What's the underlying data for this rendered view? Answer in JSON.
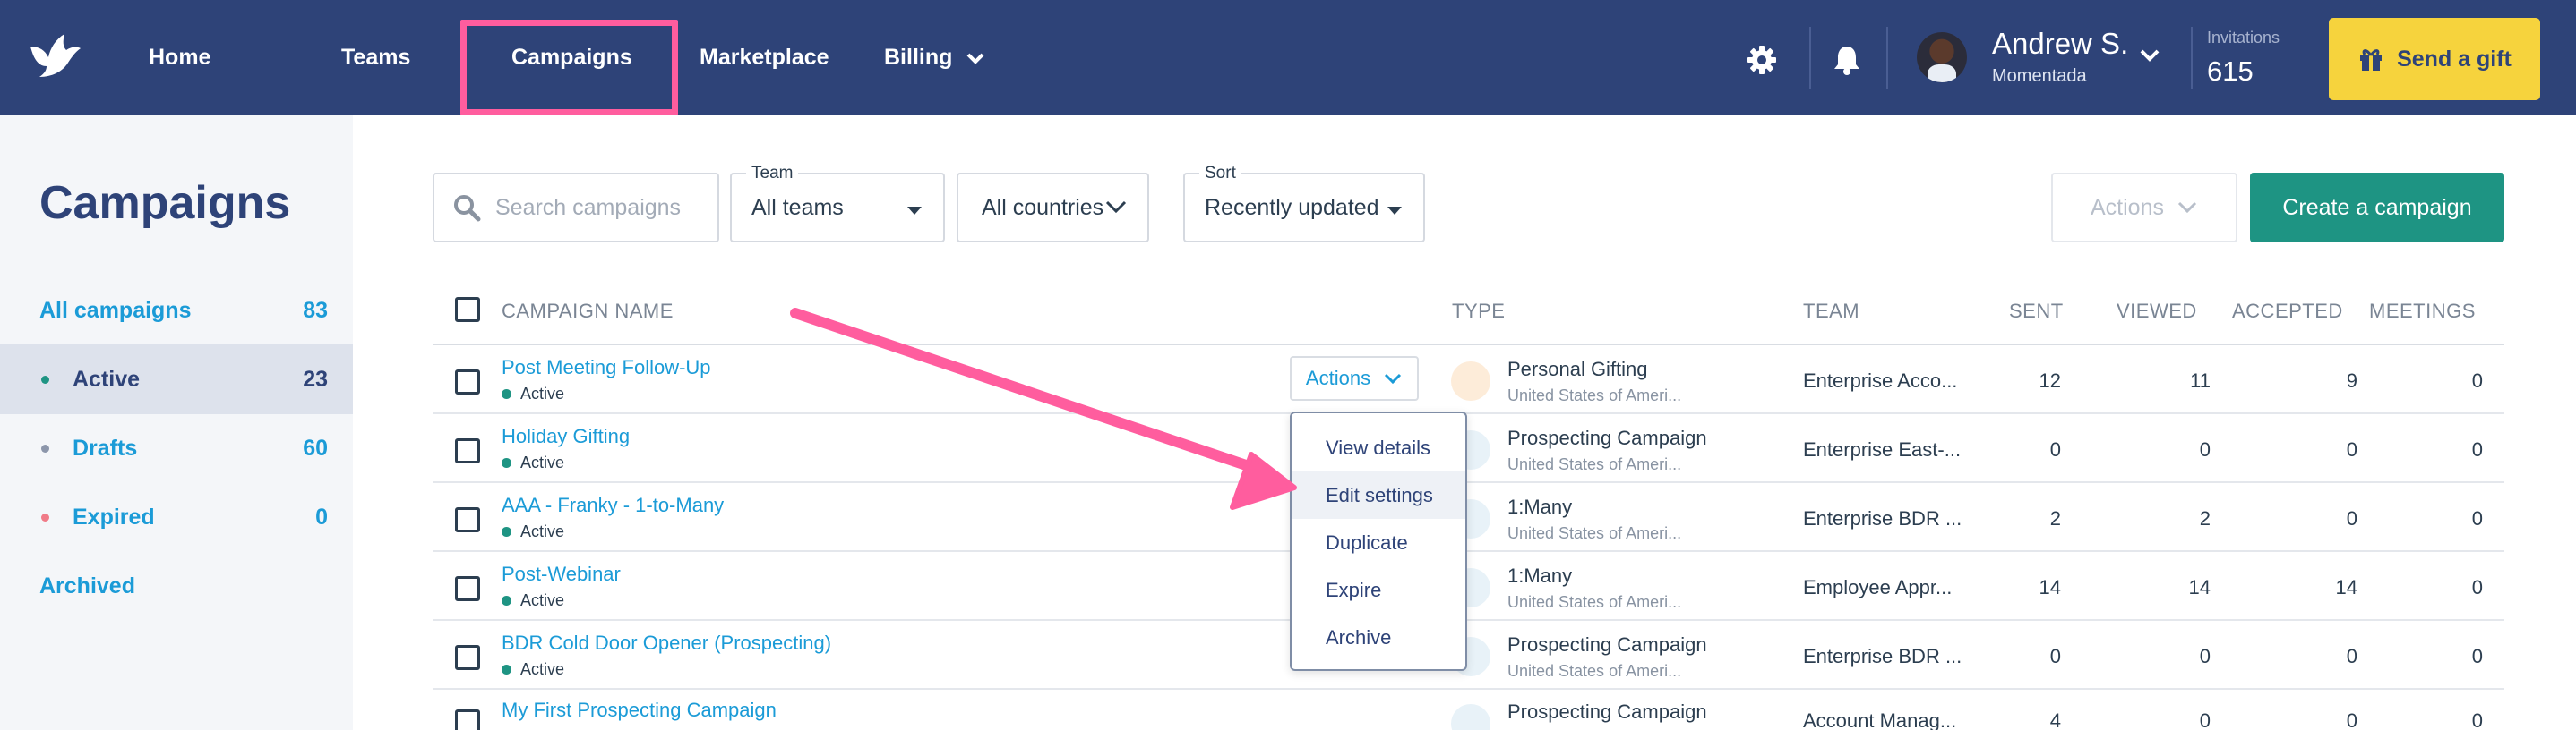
{
  "nav": {
    "items": [
      "Home",
      "Teams",
      "Campaigns",
      "Marketplace",
      "Billing"
    ],
    "user_name": "Andrew S.",
    "user_org": "Momentada",
    "invitations_label": "Invitations",
    "invitations_count": "615",
    "gift_button": "Send a gift"
  },
  "sidebar": {
    "title": "Campaigns",
    "items": [
      {
        "label": "All campaigns",
        "count": "83"
      },
      {
        "label": "Active",
        "count": "23"
      },
      {
        "label": "Drafts",
        "count": "60"
      },
      {
        "label": "Expired",
        "count": "0"
      },
      {
        "label": "Archived",
        "count": ""
      }
    ]
  },
  "toolbar": {
    "search_placeholder": "Search campaigns",
    "team_label": "Team",
    "team_value": "All teams",
    "country_value": "All countries",
    "sort_label": "Sort",
    "sort_value": "Recently updated",
    "actions_label": "Actions",
    "create_label": "Create a campaign"
  },
  "table": {
    "headers": [
      "CAMPAIGN NAME",
      "TYPE",
      "TEAM",
      "SENT",
      "VIEWED",
      "ACCEPTED",
      "MEETINGS"
    ],
    "rows": [
      {
        "name": "Post Meeting Follow-Up",
        "status": "Active",
        "type": "Personal Gifting",
        "region": "United States of Ameri...",
        "team": "Enterprise Acco...",
        "sent": "12",
        "viewed": "11",
        "accepted": "9",
        "meetings": "0"
      },
      {
        "name": "Holiday Gifting",
        "status": "Active",
        "type": "Prospecting Campaign",
        "region": "United States of Ameri...",
        "team": "Enterprise East-...",
        "sent": "0",
        "viewed": "0",
        "accepted": "0",
        "meetings": "0"
      },
      {
        "name": "AAA - Franky - 1-to-Many",
        "status": "Active",
        "type": "1:Many",
        "region": "United States of Ameri...",
        "team": "Enterprise BDR ...",
        "sent": "2",
        "viewed": "2",
        "accepted": "0",
        "meetings": "0"
      },
      {
        "name": "Post-Webinar",
        "status": "Active",
        "type": "1:Many",
        "region": "United States of Ameri...",
        "team": "Employee Appr...",
        "sent": "14",
        "viewed": "14",
        "accepted": "14",
        "meetings": "0"
      },
      {
        "name": "BDR Cold Door Opener (Prospecting)",
        "status": "Active",
        "type": "Prospecting Campaign",
        "region": "United States of Ameri...",
        "team": "Enterprise BDR ...",
        "sent": "0",
        "viewed": "0",
        "accepted": "0",
        "meetings": "0"
      },
      {
        "name": "My First Prospecting Campaign",
        "status": "",
        "type": "Prospecting Campaign",
        "region": "",
        "team": "Account Manag...",
        "sent": "4",
        "viewed": "0",
        "accepted": "0",
        "meetings": "0"
      }
    ],
    "row_actions_label": "Actions",
    "menu_items": [
      "View details",
      "Edit settings",
      "Duplicate",
      "Expire",
      "Archive"
    ]
  },
  "colors": {
    "nav_bg": "#2e4378",
    "highlight": "#ff5d9e",
    "link": "#1b9bd7",
    "primary": "#1e9483",
    "gift": "#f6d33d"
  }
}
